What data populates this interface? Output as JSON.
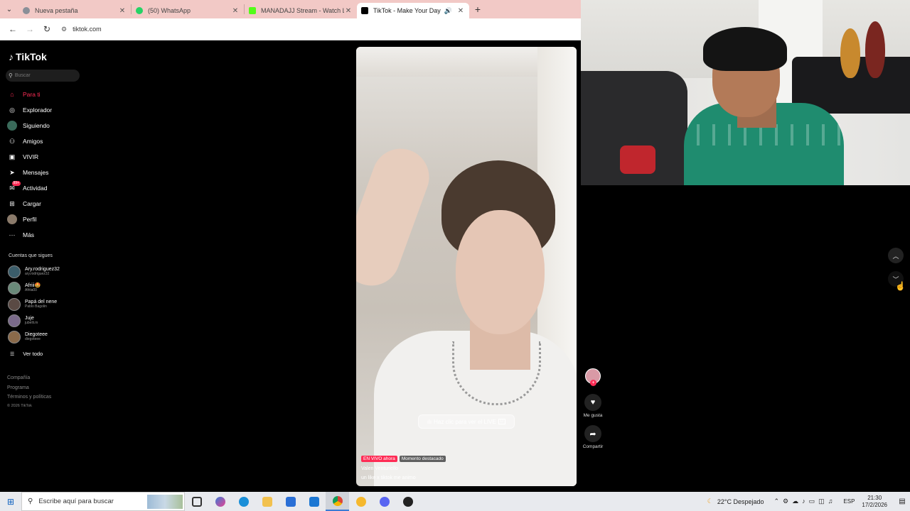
{
  "browser": {
    "tabs": [
      {
        "title": "Nueva pestaña",
        "icon": "chrome-icon",
        "color": "#8a8f98"
      },
      {
        "title": "(50) WhatsApp",
        "icon": "whatsapp-icon",
        "color": "#25d366"
      },
      {
        "title": "MANADAJJ Stream - Watch Li...",
        "icon": "kick-icon",
        "color": "#53fc18"
      },
      {
        "title": "TikTok - Make Your Day",
        "icon": "tiktok-icon",
        "color": "#000000"
      }
    ],
    "url": "tiktok.com"
  },
  "tiktok": {
    "logo": "TikTok",
    "search_placeholder": "Buscar",
    "nav": [
      {
        "label": "Para ti",
        "icon": "home-icon"
      },
      {
        "label": "Explorador",
        "icon": "compass-icon"
      },
      {
        "label": "Siguiendo",
        "icon": "following-icon"
      },
      {
        "label": "Amigos",
        "icon": "friends-icon"
      },
      {
        "label": "VIVIR",
        "icon": "live-icon"
      },
      {
        "label": "Mensajes",
        "icon": "message-icon"
      },
      {
        "label": "Actividad",
        "icon": "activity-icon",
        "badge": "99+"
      },
      {
        "label": "Cargar",
        "icon": "upload-icon"
      },
      {
        "label": "Perfil",
        "icon": "profile-icon"
      },
      {
        "label": "Más",
        "icon": "more-icon"
      }
    ],
    "following_title": "Cuentas que sigues",
    "following": [
      {
        "name": "Ary.rodriguez32",
        "handle": "ary.rodriguez32"
      },
      {
        "name": "Afriii🤩",
        "handle": "Afriia00"
      },
      {
        "name": "Papá del nene",
        "handle": "Pablo Bagolin"
      },
      {
        "name": "Juje",
        "handle": "jubelli.m"
      },
      {
        "name": "Diegoteee",
        "handle": "diegoteee"
      }
    ],
    "see_all": "Ver todo",
    "footer": [
      "Compañía",
      "Programa",
      "Términos y políticas"
    ],
    "copyright": "© 2026 TikTok",
    "video": {
      "cta": "Haz clic para ver el LIVE",
      "live_tag": "EN VIVO ahora",
      "moment_tag": "Momento destacado",
      "author": "Valen Venturiello",
      "caption": "un like x tiktok me animo"
    },
    "actions": {
      "like_label": "Me gusta",
      "share_label": "Compartir"
    }
  },
  "taskbar": {
    "search_placeholder": "Escribe aquí para buscar",
    "weather": "22°C Despejado",
    "lang": "ESP",
    "time": "21:30",
    "date": "17/2/2026"
  }
}
